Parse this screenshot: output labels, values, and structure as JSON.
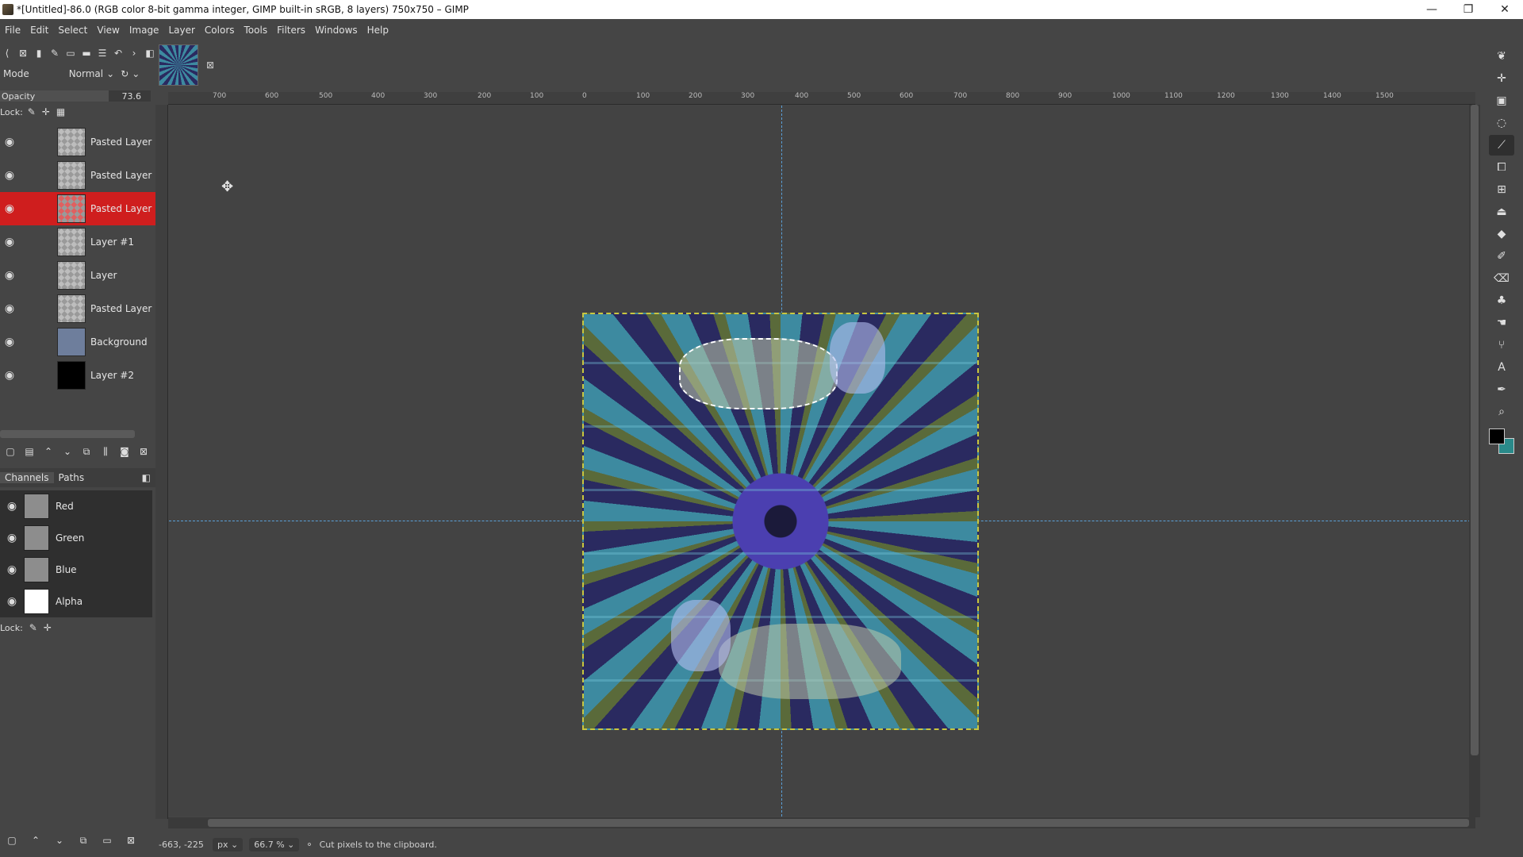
{
  "window": {
    "title": "*[Untitled]-86.0 (RGB color 8-bit gamma integer, GIMP built-in sRGB, 8 layers) 750x750 – GIMP",
    "controls": [
      "—",
      "❐",
      "✕"
    ]
  },
  "menu": [
    "File",
    "Edit",
    "Select",
    "View",
    "Image",
    "Layer",
    "Colors",
    "Tools",
    "Filters",
    "Windows",
    "Help"
  ],
  "layers_panel": {
    "mode_label": "Mode",
    "mode_value": "Normal",
    "opacity_label": "Opacity",
    "opacity_value": "73.6",
    "lock_label": "Lock:",
    "layers": [
      {
        "name": "Pasted Layer",
        "selected": false
      },
      {
        "name": "Pasted Layer",
        "selected": false
      },
      {
        "name": "Pasted Layer",
        "selected": true
      },
      {
        "name": "Layer #1",
        "selected": false
      },
      {
        "name": "Layer",
        "selected": false
      },
      {
        "name": "Pasted Layer",
        "selected": false
      },
      {
        "name": "Background",
        "selected": false
      },
      {
        "name": "Layer #2",
        "selected": false
      }
    ]
  },
  "channels_panel": {
    "tab_channels": "Channels",
    "tab_paths": "Paths",
    "lock_label": "Lock:",
    "channels": [
      "Red",
      "Green",
      "Blue",
      "Alpha"
    ]
  },
  "ruler_ticks": [
    "700",
    "600",
    "500",
    "400",
    "300",
    "200",
    "100",
    "0",
    "100",
    "200",
    "300",
    "400",
    "500",
    "600",
    "700",
    "800",
    "900",
    "1000",
    "1100",
    "1200",
    "1300",
    "1400",
    "1500"
  ],
  "status": {
    "coords": "-663, -225",
    "unit": "px",
    "zoom": "66.7 %",
    "message": "Cut pixels to the clipboard."
  },
  "colors": {
    "selected_layer": "#cf1e1e",
    "foreground": "#000000",
    "background": "#2a8a8a",
    "guide": "#5aa0d8"
  }
}
